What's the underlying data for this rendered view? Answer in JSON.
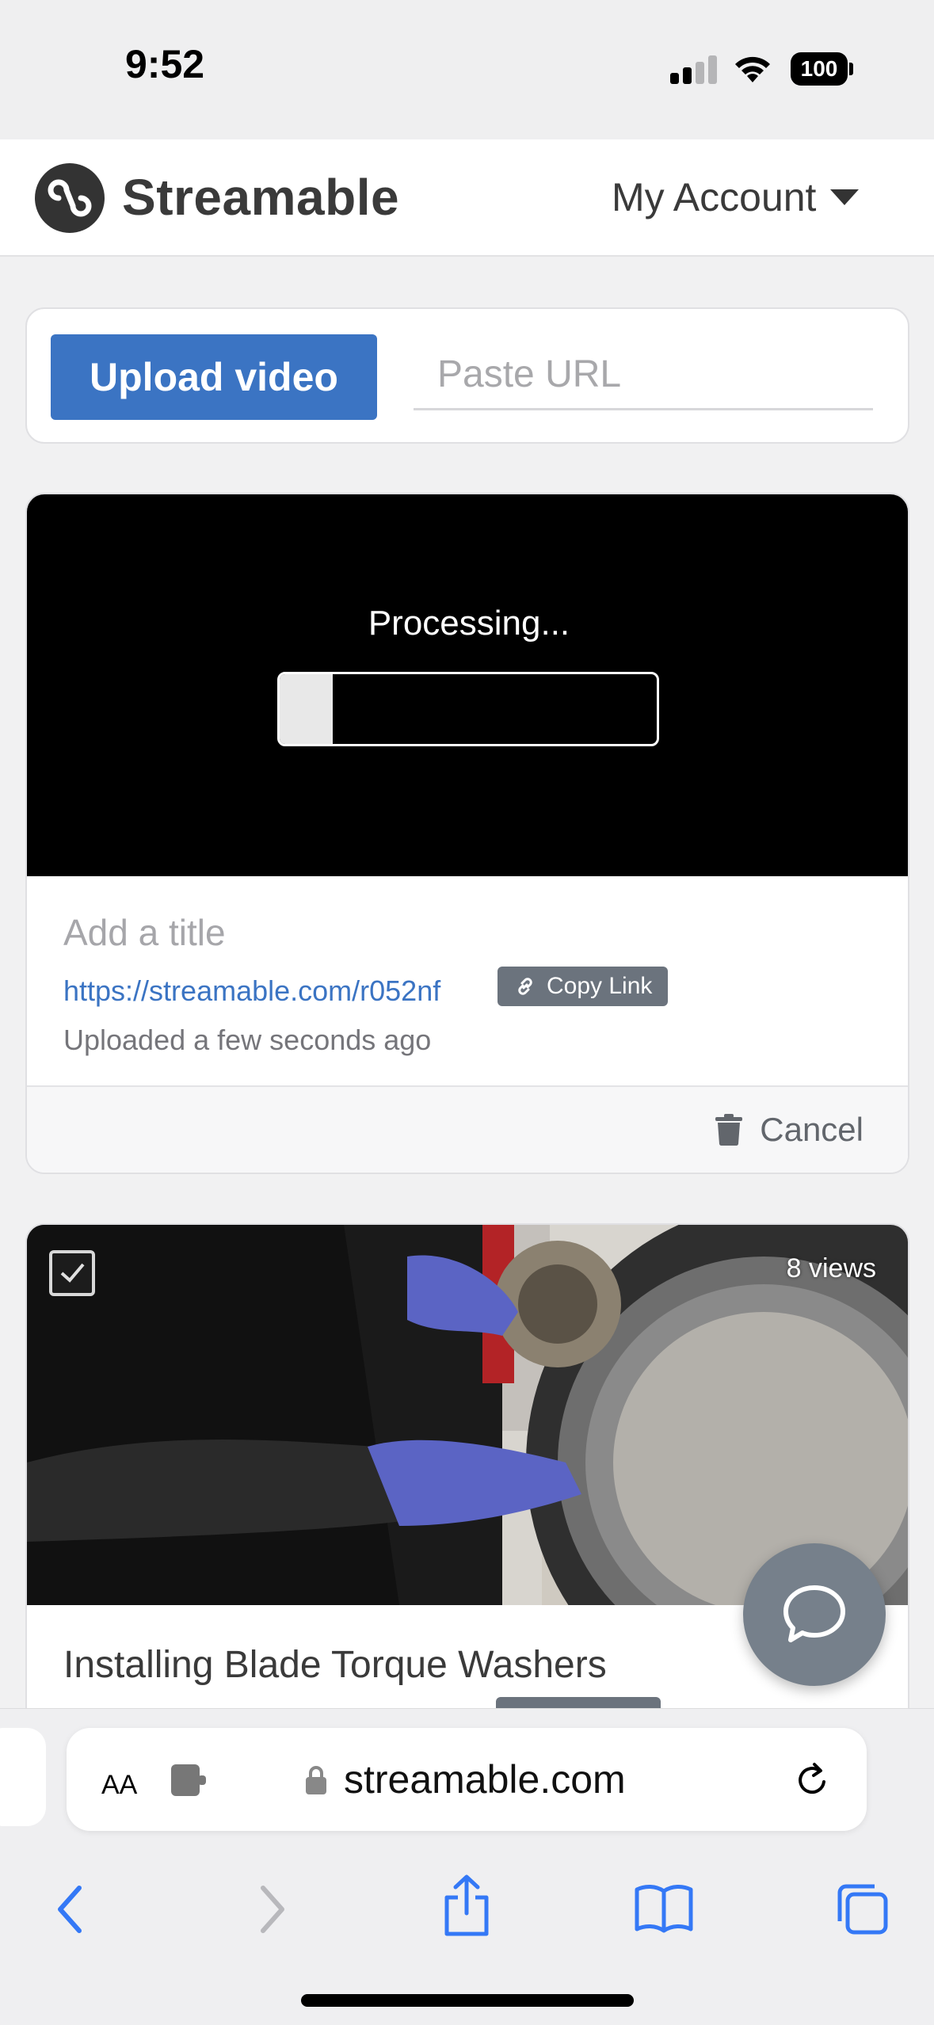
{
  "status_bar": {
    "time": "9:52",
    "battery": "100"
  },
  "header": {
    "brand": "Streamable",
    "account_label": "My Account"
  },
  "upload": {
    "button_label": "Upload video",
    "url_placeholder": "Paste URL"
  },
  "processing_card": {
    "status_label": "Processing...",
    "progress": 0.14,
    "title_placeholder": "Add a title",
    "link": "https://streamable.com/r052nf",
    "copy_label": "Copy Link",
    "uploaded": "Uploaded a few seconds ago",
    "cancel_label": "Cancel"
  },
  "video_card": {
    "views": "8 views",
    "title": "Installing Blade Torque Washers",
    "selected": true
  },
  "browser": {
    "domain": "streamable.com",
    "text_size_label": "AA"
  },
  "colors": {
    "brand_blue": "#3b74c3",
    "safari_blue": "#3478f6"
  }
}
